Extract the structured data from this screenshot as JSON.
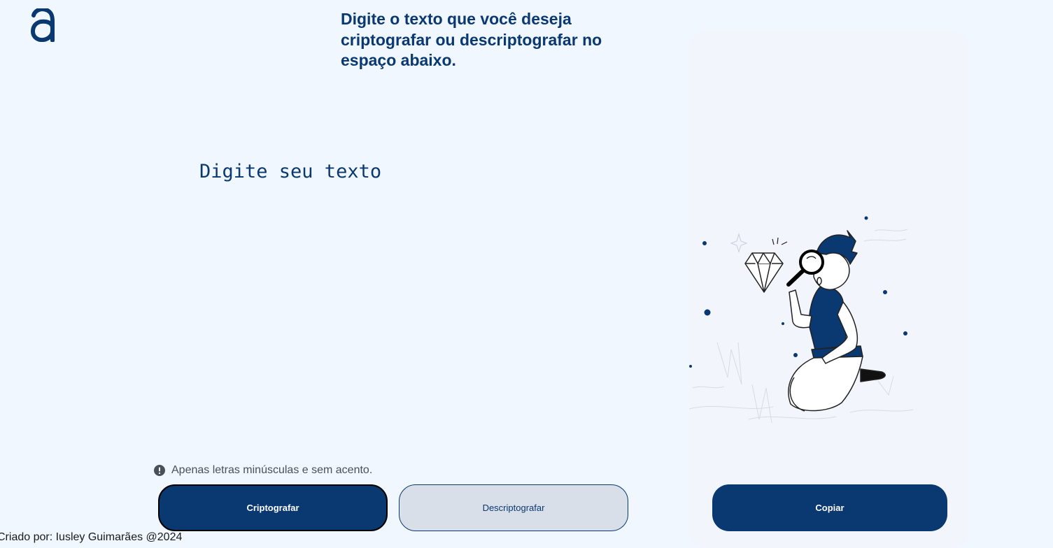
{
  "logo": {
    "icon": "alura-logo-icon",
    "color": "#0a3871"
  },
  "main": {
    "heading": "Digite o texto que você deseja criptografar ou descriptografar no espaço abaixo.",
    "input": {
      "placeholder": "Digite seu texto",
      "value": ""
    },
    "hint": {
      "icon": "exclamation-circle-icon",
      "text": "Apenas letras minúsculas e sem acento."
    },
    "buttons": {
      "encrypt_label": "Criptografar",
      "decrypt_label": "Descriptografar"
    }
  },
  "output": {
    "illustration": "person-inspecting-diamond-with-magnifier",
    "copy_label": "Copiar"
  },
  "footer": {
    "text": "Criado por: Iusley Guimarães @2024"
  },
  "colors": {
    "background": "#f0f7fe",
    "primary": "#0a3871",
    "secondary_button": "#d8dfe8",
    "panel": "#f3f5fc"
  }
}
